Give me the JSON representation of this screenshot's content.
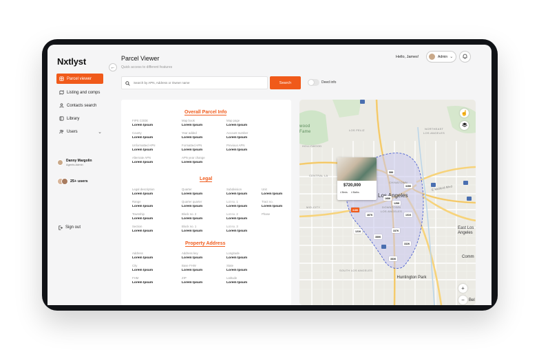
{
  "app": {
    "logo": "Nxtlyst",
    "title": "Parcel Viewer",
    "subtitle": "Quick access to different features",
    "accent_color": "#f05a1a"
  },
  "sidebar": {
    "items": [
      {
        "label": "Parcel viewer",
        "icon": "parcel-icon",
        "active": true
      },
      {
        "label": "Listing and comps",
        "icon": "map-icon"
      },
      {
        "label": "Contacts search",
        "icon": "user-icon"
      },
      {
        "label": "Library",
        "icon": "library-icon"
      },
      {
        "label": "Users",
        "icon": "users-icon"
      }
    ],
    "user_name": "Danny Margolin",
    "user_role": "Agents Admin",
    "users_count": "25+ users",
    "signout": "Sign out"
  },
  "header": {
    "greeting": "Hello, James!",
    "admin_label": "Admin"
  },
  "search": {
    "placeholder": "Search by APN, Address or Owner name",
    "button": "Search",
    "toggle_label": "Deed info"
  },
  "sections": {
    "overall_title": "Overall Parcel Info",
    "legal_title": "Legal",
    "address_title": "Property Address"
  },
  "overall_fields": [
    {
      "label": "FIPS CODE",
      "value": "Lorem Ipsum"
    },
    {
      "label": "Map book",
      "value": "Lorem Ipsum"
    },
    {
      "label": "Map page",
      "value": "Lorem Ipsum"
    },
    {
      "label": "County",
      "value": "Lorem Ipsum"
    },
    {
      "label": "Year added",
      "value": "Lorem Ipsum"
    },
    {
      "label": "Account number",
      "value": "Lorem Ipsum"
    },
    {
      "label": "Unformatted APN",
      "value": "Lorem Ipsum"
    },
    {
      "label": "Formatted APN",
      "value": "Lorem Ipsum"
    },
    {
      "label": "Previous APN",
      "value": "Lorem Ipsum"
    },
    {
      "label": "Alternate APN",
      "value": "Lorem Ipsum"
    },
    {
      "label": "APN year change",
      "value": "Lorem Ipsum"
    }
  ],
  "legal_fields": [
    {
      "label": "Legal description",
      "value": "Lorem Ipsum"
    },
    {
      "label": "Quarter",
      "value": "Lorem Ipsum"
    },
    {
      "label": "Subdivision",
      "value": "Lorem Ipsum"
    },
    {
      "label": "Unit",
      "value": "Lorem Ipsum"
    },
    {
      "label": "Range",
      "value": "Lorem Ipsum"
    },
    {
      "label": "Quarter quarter",
      "value": "Lorem Ipsum"
    },
    {
      "label": "Lot no. 1",
      "value": "Lorem Ipsum"
    },
    {
      "label": "Tract no.",
      "value": "Lorem Ipsum"
    },
    {
      "label": "Township",
      "value": "Lorem Ipsum"
    },
    {
      "label": "Block no. 2",
      "value": "Lorem Ipsum"
    },
    {
      "label": "Lot no. 2",
      "value": "Lorem Ipsum"
    },
    {
      "label": "Phase",
      "value": ""
    },
    {
      "label": "Section",
      "value": "Lorem Ipsum"
    },
    {
      "label": "Block no. 1",
      "value": "Lorem Ipsum"
    },
    {
      "label": "Lot no. 3",
      "value": "Lorem Ipsum"
    }
  ],
  "address_fields": [
    {
      "label": "Address",
      "value": "Lorem Ipsum"
    },
    {
      "label": "Address key",
      "value": "Lorem Ipsum"
    },
    {
      "label": "Longitude",
      "value": "Lorem Ipsum"
    },
    {
      "label": "City",
      "value": "Lorem Ipsum"
    },
    {
      "label": "Base FHW",
      "value": "Lorem Ipsum"
    },
    {
      "label": "State",
      "value": "Lorem Ipsum"
    },
    {
      "label": "FHM",
      "value": "Lorem Ipsum"
    },
    {
      "label": "ZIP",
      "value": "Lorem Ipsum"
    },
    {
      "label": "Latitude",
      "value": "Lorem Ipsum"
    }
  ],
  "map": {
    "labels": {
      "los_feliz": "LOS FELIZ",
      "hollywood": "HOLLYWOOD",
      "wood": "wood",
      "fame": "Fame",
      "central_la": "CENTRAL LA",
      "chinatown": "CHINATOWN",
      "mid_city": "MID-CITY",
      "downtown": "DOWNTOWN",
      "downtown2": "LOS ANGELES",
      "south_la": "SOUTH LOS ANGELES",
      "northeast": "NORTHEAST",
      "northeast2": "LOS ANGELES",
      "east_la": "East Los Angeles",
      "comm": "Comm",
      "bel": "Bel",
      "huntington": "Huntington Park",
      "city": "Los Angeles",
      "road": "E Mulford Blvd"
    },
    "popup": {
      "price": "$720,000",
      "beds": "4 Beds",
      "baths": "4 Baths"
    },
    "price_tags": [
      {
        "label": "58K"
      },
      {
        "label": "328K"
      },
      {
        "label": "168K"
      },
      {
        "label": "128K"
      },
      {
        "label": "318K",
        "active": true
      },
      {
        "label": "467K"
      },
      {
        "label": "101K"
      },
      {
        "label": "121K"
      },
      {
        "label": "386K"
      },
      {
        "label": "337K"
      },
      {
        "label": "332K"
      },
      {
        "label": "383K"
      }
    ],
    "zoom_in": "+",
    "zoom_out": "−"
  }
}
